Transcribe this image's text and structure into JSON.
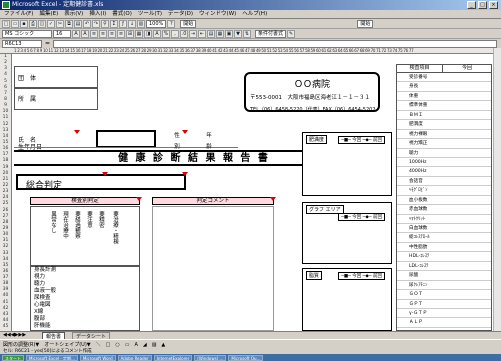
{
  "window": {
    "title": "Microsoft Excel - 定期健診書.xls"
  },
  "menu": [
    "ファイル(F)",
    "編集(E)",
    "表示(V)",
    "挿入(I)",
    "書式(O)",
    "ツール(T)",
    "データ(D)",
    "ウィンドウ(W)",
    "ヘルプ(H)"
  ],
  "toolbar": {
    "zoom": "100%",
    "font": "MS ゴシック",
    "size": "16",
    "open_label": "開始",
    "open_label2": "開始",
    "cond_format": "条件付書式"
  },
  "namebox": "R6C13",
  "form": {
    "header_fields": [
      "団　体",
      "所　属",
      "氏　名",
      "生年月日"
    ],
    "sex_label": "性　別",
    "age_label": "年　齢",
    "clinic_name": "ＯＯ病院",
    "clinic_addr": "〒553-0001　大阪市福島区海老江１－１－３１",
    "clinic_tel": "TEL（06）6458-5220（代表）FAX（06）6454-5202",
    "report_title": "健 康 診 断 結 果 報 告 書",
    "overall_label": "総合判定",
    "per_item_label": "検査別判定",
    "comment_label": "判定コメント",
    "judge_cols": [
      "異常なし",
      "現在治療中",
      "要経過観察",
      "要注意",
      "要精密",
      "要治療・精検"
    ],
    "row_items": [
      "身長計測",
      "視力",
      "聴力",
      "血液一般",
      "尿検査",
      "心電図",
      "X線",
      "腹部",
      "肝機能"
    ],
    "right_header": [
      "検査項目",
      "今回"
    ],
    "right_items": [
      "受診番号",
      "身長",
      "体重",
      "標準体重",
      "ＢＭＩ",
      "肥満度",
      "視力裸眼",
      "視力矯正",
      "聴力",
      "1000Hz",
      "4000Hz",
      "会話音",
      "ﾍﾓｸﾞﾛﾋﾞﾝ",
      "血小板数",
      "赤血球数",
      "ﾍﾏﾄｸﾘｯﾄ",
      "白血球数",
      "総ｺﾚｽﾃﾛｰﾙ",
      "中性脂肪",
      "HDL-ｺﾚｽﾃ",
      "LDL-ｺﾚｽﾃ",
      "尿酸",
      "尿ｸﾚｱﾁﾆﾝ",
      "ＧＯＴ",
      "ＧＰＴ",
      "γ-ＧＴＰ",
      "ＡＬＰ"
    ],
    "right_groups": [
      "身体計測",
      "視力",
      "聴力",
      "血液一般",
      "生化学",
      "肝機能"
    ],
    "chart1": {
      "title": "肥満度",
      "legend": [
        "今回",
        "前回"
      ]
    },
    "chart2": {
      "title": "血圧",
      "legend": [
        "今回",
        "前回"
      ],
      "tooltip": "グラフ エリア"
    },
    "chart3": {
      "title": "脂質",
      "legend": [
        "今回",
        "前回"
      ]
    },
    "red_marks": [
      "※",
      "※",
      "※"
    ]
  },
  "sheet_tabs": [
    "報告書",
    "データシート"
  ],
  "drawbar": "図形の調整(R)▼　オートシェイプ(U)▼　＼　□　○　▭　A　◢　▨　▲",
  "status": "セル: R6C21 - yes[50]によるコメント作成",
  "taskbar": [
    "スタート",
    "Microsoft Excel - 定期...",
    "Microsoft Word",
    "Adobe Reader",
    "InternetExplorer",
    "(Windows) ...",
    "Microsoft Ou..."
  ]
}
